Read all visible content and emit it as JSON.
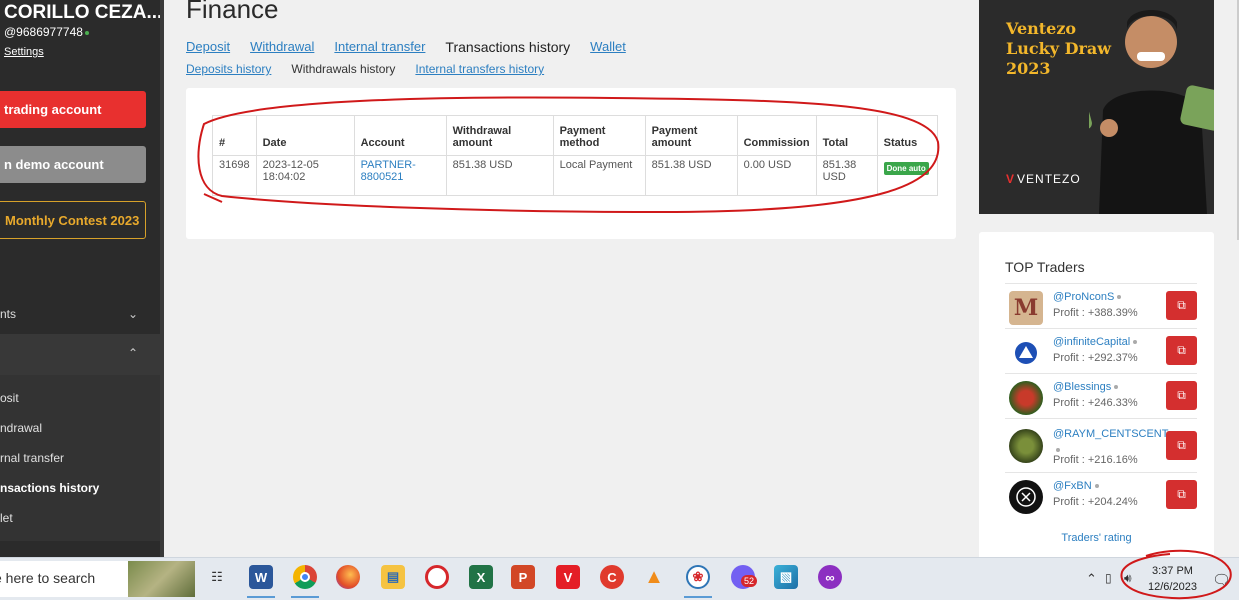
{
  "sidebar": {
    "user_name": "CORILLO CEZA...",
    "user_phone": "@9686977748",
    "settings": "Settings",
    "btn_trading": "trading account",
    "btn_demo": "n demo account",
    "btn_contest": "Monthly Contest 2023",
    "menu_accounts": "nts",
    "submenu": [
      "osit",
      "ndrawal",
      "rnal transfer",
      "nsactions history",
      "let"
    ]
  },
  "main": {
    "title": "Finance",
    "tabs": [
      "Deposit",
      "Withdrawal",
      "Internal transfer",
      "Transactions history",
      "Wallet"
    ],
    "subtabs": [
      "Deposits history",
      "Withdrawals history",
      "Internal transfers history"
    ],
    "table": {
      "headers": [
        "#",
        "Date",
        "Account",
        "Withdrawal amount",
        "Payment method",
        "Payment amount",
        "Commission",
        "Total",
        "Status"
      ],
      "row": {
        "id": "31698",
        "date": "2023-12-05 18:04:02",
        "account": "PARTNER-8800521",
        "withdrawal_amount": "851.38 USD",
        "payment_method": "Local Payment",
        "payment_amount": "851.38 USD",
        "commission": "0.00 USD",
        "total": "851.38 USD",
        "status": "Done auto"
      }
    }
  },
  "ad": {
    "line1": "Ventezo",
    "line2": "Lucky Draw",
    "line3": "2023",
    "logo_text": "VENTEZO"
  },
  "top_traders": {
    "title": "TOP Traders",
    "traders": [
      {
        "name": "@ProNconS",
        "profit": "Profit : +388.39%"
      },
      {
        "name": "@infiniteCapital",
        "profit": "Profit : +292.37%"
      },
      {
        "name": "@Blessings",
        "profit": "Profit : +246.33%"
      },
      {
        "name": "@RAYM_CENTSCENT",
        "profit": "Profit : +216.16%"
      },
      {
        "name": "@FxBN",
        "profit": "Profit : +204.24%"
      }
    ],
    "rating_link": "Traders' rating"
  },
  "taskbar": {
    "search_text": "e here to search",
    "badge_count": "52",
    "time": "3:37 PM",
    "date": "12/6/2023"
  },
  "colors": {
    "accent_link": "#2c7fc1",
    "danger": "#d42f2f",
    "success": "#3aa64a",
    "gold": "#f3b72b"
  }
}
